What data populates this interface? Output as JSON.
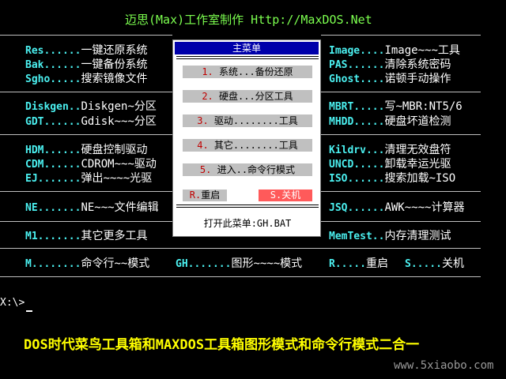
{
  "header": {
    "title": "迈思(Max)工作室制作 Http://MaxDOS.Net"
  },
  "left": [
    {
      "code": "Res......",
      "desc": "一键还原系统"
    },
    {
      "code": "Bak......",
      "desc": "一键备份系统"
    },
    {
      "code": "Sgho.....",
      "desc": "搜索镜像文件"
    },
    {
      "code": "Diskgen..",
      "desc": "Diskgen~分区"
    },
    {
      "code": "GDT......",
      "desc": "Gdisk~~~分区"
    },
    {
      "code": "HDM......",
      "desc": "硬盘控制驱动"
    },
    {
      "code": "CDM......",
      "desc": "CDROM~~~驱动"
    },
    {
      "code": "EJ.......",
      "desc": "弹出~~~~光驱"
    },
    {
      "code": "NE.......",
      "desc": "NE~~~文件编辑"
    },
    {
      "code": "M1.......",
      "desc": "其它更多工具"
    },
    {
      "code": "M........",
      "desc": "命令行~~模式"
    }
  ],
  "right": [
    {
      "code": "Image....",
      "desc": "Image~~~工具"
    },
    {
      "code": "PAS......",
      "desc": "清除系统密码"
    },
    {
      "code": "Ghost....",
      "desc": "诺顿手动操作"
    },
    {
      "code": "MBRT.....",
      "desc": "写~MBR:NT5/6"
    },
    {
      "code": "MHDD.....",
      "desc": "硬盘坏道检测"
    },
    {
      "code": "Kildrv...",
      "desc": "清理无效盘符"
    },
    {
      "code": "UNCD.....",
      "desc": "卸载幸运光驱"
    },
    {
      "code": "ISO......",
      "desc": "搜索加载~ISO"
    },
    {
      "code": "JSQ......",
      "desc": "AWK~~~~计算器"
    },
    {
      "code": "MemTest..",
      "desc": "内存清理测试"
    }
  ],
  "bottom_row": [
    {
      "code": "GH.......",
      "desc": "图形~~~~模式"
    },
    {
      "code": "R.....",
      "desc": "重启"
    },
    {
      "code": "S.....",
      "desc": "关机"
    }
  ],
  "menu": {
    "title": "主菜单",
    "items": [
      {
        "num": "1.",
        "label": " 系统...备份还原"
      },
      {
        "num": "2.",
        "label": " 硬盘...分区工具"
      },
      {
        "num": "3.",
        "label": " 驱动........工具"
      },
      {
        "num": "4.",
        "label": " 其它........工具"
      },
      {
        "num": "5.",
        "label": " 进入..命令行模式"
      }
    ],
    "restart": {
      "key": "R.",
      "label": "重启"
    },
    "shutdown": {
      "key": "S.",
      "label": "关机"
    },
    "footer": "打开此菜单:GH.BAT",
    "separator": "========================="
  },
  "prompt": "X:\\>",
  "caption": "DOS时代菜鸟工具箱和MAXDOS工具箱图形模式和命令行模式二合一",
  "watermark": "www.5xiaobo.com"
}
